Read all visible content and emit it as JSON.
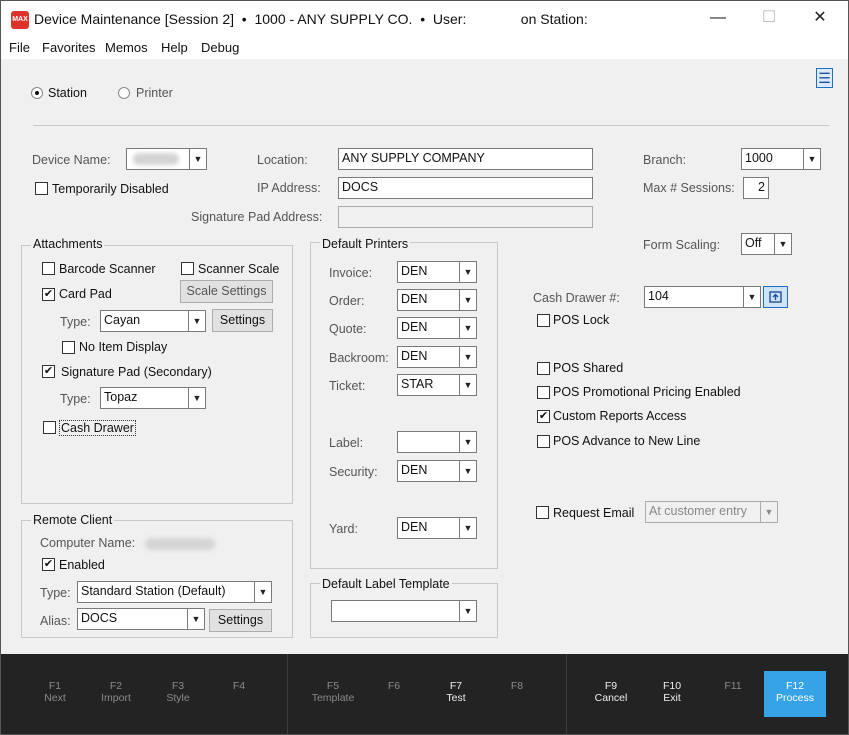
{
  "window": {
    "icon_text": "MAX",
    "title": "Device Maintenance [Session 2]  •  1000 - ANY SUPPLY CO.  •  User:              on Station:",
    "minimize_glyph": "—",
    "maximize_glyph": "☐",
    "close_glyph": "✕"
  },
  "menu": [
    "File",
    "Favorites",
    "Memos",
    "Help",
    "Debug"
  ],
  "hamburger_glyph": "☰",
  "mode": {
    "station_label": "Station",
    "printer_label": "Printer"
  },
  "device": {
    "name_label": "Device Name:",
    "temp_disabled_label": "Temporarily Disabled",
    "location_label": "Location:",
    "location_value": "ANY SUPPLY COMPANY",
    "ip_label": "IP Address:",
    "ip_value": "DOCS",
    "sig_addr_label": "Signature Pad Address:",
    "sig_addr_value": "",
    "branch_label": "Branch:",
    "branch_value": "1000",
    "max_sessions_label": "Max # Sessions:",
    "max_sessions_value": "2"
  },
  "attachments": {
    "title": "Attachments",
    "barcode_scanner": "Barcode Scanner",
    "scanner_scale": "Scanner Scale",
    "scale_settings": "Scale Settings",
    "card_pad": "Card Pad",
    "type_label": "Type:",
    "card_type": "Cayan",
    "settings": "Settings",
    "no_item_display": "No Item Display",
    "signature_pad": "Signature Pad (Secondary)",
    "sig_type": "Topaz",
    "cash_drawer": "Cash Drawer"
  },
  "printers": {
    "title": "Default Printers",
    "rows": [
      {
        "label": "Invoice:",
        "value": "DEN"
      },
      {
        "label": "Order:",
        "value": "DEN"
      },
      {
        "label": "Quote:",
        "value": "DEN"
      },
      {
        "label": "Backroom:",
        "value": "DEN"
      },
      {
        "label": "Ticket:",
        "value": "STAR"
      },
      {
        "label": "Label:",
        "value": ""
      },
      {
        "label": "Security:",
        "value": "DEN"
      },
      {
        "label": "Yard:",
        "value": "DEN"
      }
    ]
  },
  "label_template": {
    "title": "Default Label Template",
    "value": ""
  },
  "remote": {
    "title": "Remote Client",
    "computer_name_label": "Computer Name:",
    "enabled_label": "Enabled",
    "type_label": "Type:",
    "type_value": "Standard Station (Default)",
    "alias_label": "Alias:",
    "alias_value": "DOCS",
    "settings": "Settings"
  },
  "right": {
    "form_scaling_label": "Form Scaling:",
    "form_scaling_value": "Off",
    "cash_drawer_label": "Cash Drawer #:",
    "cash_drawer_value": "104",
    "pos_lock": "POS Lock",
    "pos_shared": "POS Shared",
    "pos_promo": "POS Promotional Pricing Enabled",
    "custom_reports": "Custom Reports Access",
    "pos_advance": "POS Advance to New Line",
    "request_email": "Request Email",
    "request_email_value": "At customer entry"
  },
  "check_glyph": "✔",
  "dropdown_glyph": "▼",
  "fkeys": [
    {
      "key": "F1",
      "label": "Next"
    },
    {
      "key": "F2",
      "label": "Import"
    },
    {
      "key": "F3",
      "label": "Style"
    },
    {
      "key": "F4",
      "label": ""
    },
    {
      "key": "F5",
      "label": "Template"
    },
    {
      "key": "F6",
      "label": ""
    },
    {
      "key": "F7",
      "label": "Test"
    },
    {
      "key": "F8",
      "label": ""
    },
    {
      "key": "F9",
      "label": "Cancel"
    },
    {
      "key": "F10",
      "label": "Exit"
    },
    {
      "key": "F11",
      "label": ""
    },
    {
      "key": "F12",
      "label": "Process"
    }
  ],
  "colors": {
    "accent": "#35a3e6",
    "icon_red": "#e0322c",
    "footer": "#232323"
  }
}
